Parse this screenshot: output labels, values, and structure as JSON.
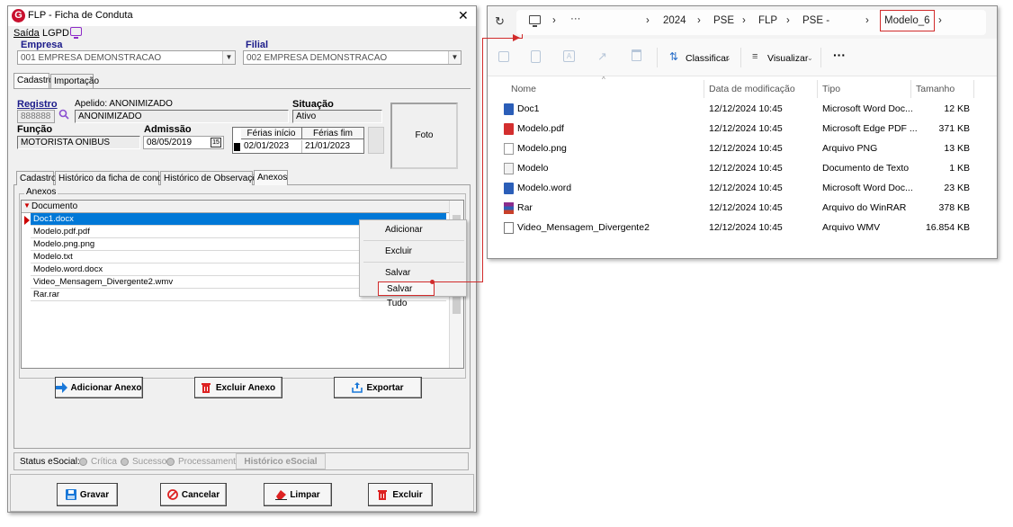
{
  "flp": {
    "title": "FLP - Ficha de Conduta",
    "logo_letter": "G",
    "menu": {
      "saida": "Saída",
      "lgpd": "LGPD"
    },
    "empresa": {
      "label": "Empresa",
      "value": "001 EMPRESA DEMONSTRACAO"
    },
    "filial": {
      "label": "Filial",
      "value": "002 EMPRESA DEMONSTRACAO"
    },
    "top_tabs": [
      "Cadastro",
      "Importação"
    ],
    "registro": {
      "label": "Registro",
      "value": "888888"
    },
    "apelido": {
      "label": "Apelido: ANONIMIZADO",
      "value": "ANONIMIZADO"
    },
    "situacao": {
      "label": "Situação",
      "value": "Ativo"
    },
    "funcao": {
      "label": "Função",
      "value": "MOTORISTA ONIBUS"
    },
    "admissao": {
      "label": "Admissão",
      "value": "08/05/2019"
    },
    "ferias": {
      "inicio_label": "Férias início",
      "fim_label": "Férias fim",
      "inicio": "02/01/2023",
      "fim": "21/01/2023"
    },
    "foto_label": "Foto",
    "inner_tabs": [
      "Cadastro",
      "Histórico da ficha de conduta",
      "Histórico de Observações",
      "Anexos"
    ],
    "anexos": {
      "group_label": "Anexos",
      "column": "Documento",
      "rows": [
        "Doc1.docx",
        "Modelo.pdf.pdf",
        "Modelo.png.png",
        "Modelo.txt",
        "Modelo.word.docx",
        "Video_Mensagem_Divergente2.wmv",
        "Rar.rar"
      ]
    },
    "context_menu": [
      "Adicionar",
      "Excluir",
      "Salvar",
      "Salvar Tudo"
    ],
    "buttons": {
      "adicionar_anexo": "Adicionar Anexo",
      "excluir_anexo": "Excluir Anexo",
      "exportar": "Exportar"
    },
    "status": {
      "label": "Status eSocial:",
      "critica": "Crítica",
      "sucesso": "Sucesso",
      "processamento": "Processamento",
      "historico": "Histórico eSocial"
    },
    "bottom_buttons": {
      "gravar": "Gravar",
      "cancelar": "Cancelar",
      "limpar": "Limpar",
      "excluir": "Excluir"
    }
  },
  "explorer": {
    "breadcrumb": [
      "2024",
      "PSE",
      "FLP",
      "PSE -",
      "Modelo_6"
    ],
    "ellipsis": "···",
    "toolbar": {
      "classificar": "Classificar",
      "visualizar": "Visualizar",
      "more": "···"
    },
    "columns": [
      "Nome",
      "Data de modificação",
      "Tipo",
      "Tamanho"
    ],
    "files": [
      {
        "name": "Doc1",
        "date": "12/12/2024 10:45",
        "type": "Microsoft Word Doc...",
        "size": "12 KB",
        "icon": "word-icon"
      },
      {
        "name": "Modelo.pdf",
        "date": "12/12/2024 10:45",
        "type": "Microsoft Edge PDF ...",
        "size": "371 KB",
        "icon": "pdf-icon"
      },
      {
        "name": "Modelo.png",
        "date": "12/12/2024 10:45",
        "type": "Arquivo PNG",
        "size": "13 KB",
        "icon": "image-file-icon"
      },
      {
        "name": "Modelo",
        "date": "12/12/2024 10:45",
        "type": "Documento de Texto",
        "size": "1 KB",
        "icon": "text-file-icon"
      },
      {
        "name": "Modelo.word",
        "date": "12/12/2024 10:45",
        "type": "Microsoft Word Doc...",
        "size": "23 KB",
        "icon": "word-icon"
      },
      {
        "name": "Rar",
        "date": "12/12/2024 10:45",
        "type": "Arquivo do WinRAR",
        "size": "378 KB",
        "icon": "rar-icon"
      },
      {
        "name": "Video_Mensagem_Divergente2",
        "date": "12/12/2024 10:45",
        "type": "Arquivo WMV",
        "size": "16.854 KB",
        "icon": "video-icon"
      }
    ]
  },
  "colors": {
    "highlight": "#d12b2b",
    "selection": "#0078d7",
    "label_blue": "#1b1b8a"
  }
}
